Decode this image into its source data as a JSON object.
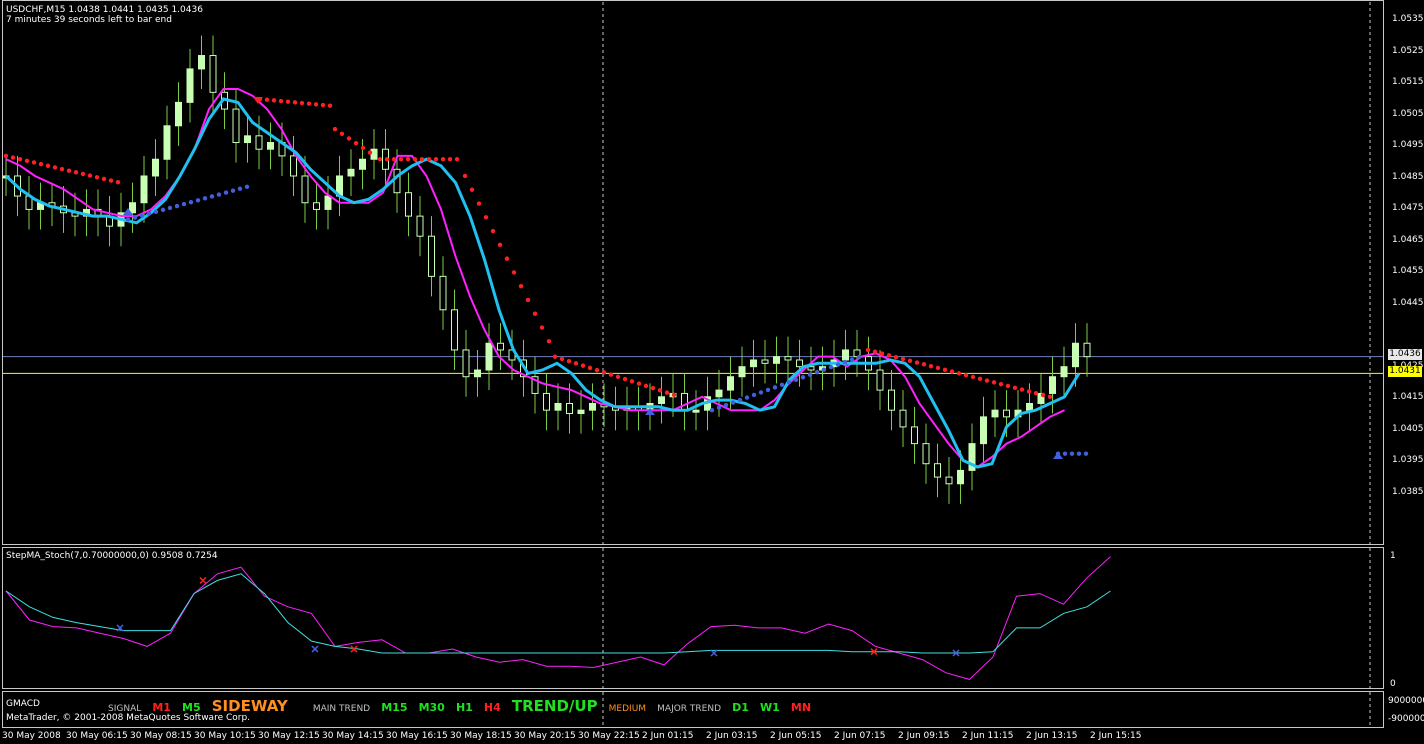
{
  "chart_title": "USDCHF,M15  1.0438 1.0441 1.0435 1.0436",
  "bar_timer": "7 minutes 39 seconds left to bar end",
  "price_axis": [
    "1.0535",
    "1.0525",
    "1.0515",
    "1.0505",
    "1.0495",
    "1.0485",
    "1.0475",
    "1.0465",
    "1.0455",
    "1.0445",
    "1.0425",
    "1.0415",
    "1.0405",
    "1.0395",
    "1.0385"
  ],
  "bid_tag": "1.0436",
  "line_tag": "1.0431",
  "stoch_title": "StepMA_Stoch(7,0.70000000,0) 0.9508 0.7254",
  "stoch_axis": [
    "1",
    "0"
  ],
  "gmacd_axis": [
    "9000000",
    "-9000000"
  ],
  "time_axis": [
    "30 May 2008",
    "30 May 06:15",
    "30 May 08:15",
    "30 May 10:15",
    "30 May 12:15",
    "30 May 14:15",
    "30 May 16:15",
    "30 May 18:15",
    "30 May 20:15",
    "30 May 22:15",
    "2 Jun 01:15",
    "2 Jun 03:15",
    "2 Jun 05:15",
    "2 Jun 07:15",
    "2 Jun 09:15",
    "2 Jun 11:15",
    "2 Jun 13:15",
    "2 Jun 15:15"
  ],
  "gmacd": {
    "name": "GMACD",
    "signal_label": "SIGNAL",
    "signal_tf": [
      {
        "t": "M1",
        "c": "#ff2020"
      },
      {
        "t": "M5",
        "c": "#20e020"
      }
    ],
    "signal_state": "SIDEWAY",
    "main_label": "MAIN TREND",
    "main_tf": [
      {
        "t": "M15",
        "c": "#20e020"
      },
      {
        "t": "M30",
        "c": "#20e020"
      },
      {
        "t": "H1",
        "c": "#20e020"
      },
      {
        "t": "H4",
        "c": "#ff2020"
      }
    ],
    "main_state": "TREND/UP",
    "strength": "MEDIUM",
    "major_label": "MAJOR TREND",
    "major_tf": [
      {
        "t": "D1",
        "c": "#20e020"
      },
      {
        "t": "W1",
        "c": "#20e020"
      },
      {
        "t": "MN",
        "c": "#ff2020"
      }
    ]
  },
  "copyright": "MetaTrader, © 2001-2008 MetaQuotes Software Corp.",
  "colors": {
    "candle": "#c8ffb4",
    "wick": "#7ccd44",
    "fast_ma": "#20c0f0",
    "slow_ma": "#ff20ff",
    "stop_red": "#ff2020",
    "stop_blue": "#4060e0",
    "bid_line": "#7080c0",
    "level_line": "#ffff00",
    "stoch_main": "#ff20ff",
    "stoch_signal": "#40e0e0"
  },
  "chart_data": {
    "type": "line",
    "symbol": "USDCHF",
    "timeframe": "M15",
    "ylim": [
      1.038,
      1.0542
    ],
    "close_series": [
      1.049,
      1.0484,
      1.048,
      1.0482,
      1.0481,
      1.0479,
      1.0478,
      1.048,
      1.0478,
      1.0475,
      1.0479,
      1.0482,
      1.049,
      1.0495,
      1.0505,
      1.0512,
      1.0522,
      1.0526,
      1.0515,
      1.051,
      1.05,
      1.0502,
      1.0498,
      1.05,
      1.0496,
      1.049,
      1.0482,
      1.048,
      1.0484,
      1.049,
      1.0492,
      1.0495,
      1.0498,
      1.0492,
      1.0485,
      1.0478,
      1.0472,
      1.046,
      1.045,
      1.0438,
      1.043,
      1.0432,
      1.044,
      1.0438,
      1.0435,
      1.043,
      1.0425,
      1.042,
      1.0422,
      1.0419,
      1.042,
      1.0422,
      1.0421,
      1.042,
      1.0421,
      1.042,
      1.0422,
      1.0424,
      1.0425,
      1.042,
      1.042,
      1.0424,
      1.0426,
      1.043,
      1.0433,
      1.0435,
      1.0434,
      1.0436,
      1.0435,
      1.0433,
      1.0432,
      1.0433,
      1.0435,
      1.0438,
      1.0436,
      1.0432,
      1.0426,
      1.042,
      1.0415,
      1.041,
      1.0404,
      1.04,
      1.0398,
      1.0402,
      1.041,
      1.0418,
      1.042,
      1.0418,
      1.042,
      1.0422,
      1.0425,
      1.043,
      1.0433,
      1.044,
      1.0436
    ],
    "fast_ma": [
      1.049,
      1.0486,
      1.0483,
      1.0481,
      1.048,
      1.0479,
      1.0478,
      1.0478,
      1.0477,
      1.0476,
      1.0479,
      1.0483,
      1.049,
      1.0498,
      1.0507,
      1.0513,
      1.0512,
      1.0506,
      1.0503,
      1.05,
      1.0497,
      1.0492,
      1.0488,
      1.0484,
      1.0482,
      1.0483,
      1.0486,
      1.049,
      1.0493,
      1.0495,
      1.0493,
      1.0488,
      1.0478,
      1.0465,
      1.045,
      1.0438,
      1.0431,
      1.0432,
      1.0434,
      1.0431,
      1.0426,
      1.0423,
      1.0421,
      1.0421,
      1.0421,
      1.0421,
      1.042,
      1.042,
      1.0422,
      1.0423,
      1.0423,
      1.0422,
      1.042,
      1.0421,
      1.0429,
      1.0433,
      1.0434,
      1.0434,
      1.0434,
      1.0434,
      1.0434,
      1.0435,
      1.0434,
      1.043,
      1.0422,
      1.0414,
      1.0405,
      1.0403,
      1.0404,
      1.0415,
      1.0419,
      1.042,
      1.0422,
      1.0424,
      1.0431
    ],
    "slow_ma": [
      1.0495,
      1.0493,
      1.049,
      1.0488,
      1.0486,
      1.0483,
      1.048,
      1.0479,
      1.0478,
      1.0478,
      1.048,
      1.0484,
      1.049,
      1.0498,
      1.051,
      1.0516,
      1.0516,
      1.0514,
      1.051,
      1.0504,
      1.0496,
      1.049,
      1.0485,
      1.0482,
      1.0482,
      1.0482,
      1.0485,
      1.0496,
      1.0496,
      1.049,
      1.048,
      1.0466,
      1.0454,
      1.0444,
      1.0436,
      1.0432,
      1.043,
      1.0428,
      1.0427,
      1.0426,
      1.0424,
      1.0422,
      1.0421,
      1.042,
      1.042,
      1.042,
      1.042,
      1.0422,
      1.0424,
      1.0422,
      1.042,
      1.042,
      1.042,
      1.0423,
      1.0428,
      1.0432,
      1.0436,
      1.0436,
      1.0433,
      1.0436,
      1.0437,
      1.0435,
      1.043,
      1.0422,
      1.0416,
      1.041,
      1.0405,
      1.0403,
      1.0406,
      1.041,
      1.0412,
      1.0415,
      1.0418,
      1.042
    ]
  }
}
